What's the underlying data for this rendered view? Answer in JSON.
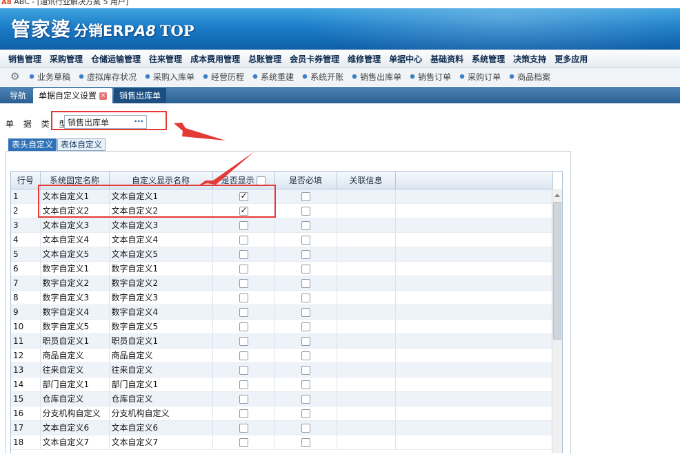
{
  "window": {
    "title": "ABC - [通讯行业解决方案 5 用户]"
  },
  "banner": {
    "logo_main": "管家婆",
    "logo_sub": "分销ERP",
    "logo_version": "A8",
    "logo_top": "TOP"
  },
  "main_menu": [
    "销售管理",
    "采购管理",
    "仓储运输管理",
    "往来管理",
    "成本费用管理",
    "总账管理",
    "会员卡券管理",
    "维修管理",
    "单据中心",
    "基础资料",
    "系统管理",
    "决策支持",
    "更多应用"
  ],
  "quick_bar": [
    "业务草稿",
    "虚拟库存状况",
    "采购入库单",
    "经营历程",
    "系统重建",
    "系统开账",
    "销售出库单",
    "销售订单",
    "采购订单",
    "商品档案"
  ],
  "tabs": [
    {
      "label": "导航"
    },
    {
      "label": "单据自定义设置",
      "close": "×"
    },
    {
      "label": "销售出库单"
    }
  ],
  "form": {
    "type_label": "单 据 类 型:",
    "type_value": "销售出库单",
    "type_button": "···"
  },
  "sub_tabs": [
    "表头自定义",
    "表体自定义"
  ],
  "grid": {
    "headers": [
      "行号",
      "系统固定名称",
      "自定义显示名称",
      "是否显示",
      "是否必填",
      "关联信息"
    ],
    "rows": [
      {
        "no": "1",
        "sys": "文本自定义1",
        "custom": "文本自定义1",
        "show": true,
        "required": false
      },
      {
        "no": "2",
        "sys": "文本自定义2",
        "custom": "文本自定义2",
        "show": true,
        "required": false
      },
      {
        "no": "3",
        "sys": "文本自定义3",
        "custom": "文本自定义3",
        "show": false,
        "required": false
      },
      {
        "no": "4",
        "sys": "文本自定义4",
        "custom": "文本自定义4",
        "show": false,
        "required": false
      },
      {
        "no": "5",
        "sys": "文本自定义5",
        "custom": "文本自定义5",
        "show": false,
        "required": false
      },
      {
        "no": "6",
        "sys": "数字自定义1",
        "custom": "数字自定义1",
        "show": false,
        "required": false
      },
      {
        "no": "7",
        "sys": "数字自定义2",
        "custom": "数字自定义2",
        "show": false,
        "required": false
      },
      {
        "no": "8",
        "sys": "数字自定义3",
        "custom": "数字自定义3",
        "show": false,
        "required": false
      },
      {
        "no": "9",
        "sys": "数字自定义4",
        "custom": "数字自定义4",
        "show": false,
        "required": false
      },
      {
        "no": "10",
        "sys": "数字自定义5",
        "custom": "数字自定义5",
        "show": false,
        "required": false
      },
      {
        "no": "11",
        "sys": "职员自定义1",
        "custom": "职员自定义1",
        "show": false,
        "required": false
      },
      {
        "no": "12",
        "sys": "商品自定义",
        "custom": "商品自定义",
        "show": false,
        "required": false
      },
      {
        "no": "13",
        "sys": "往来自定义",
        "custom": "往来自定义",
        "show": false,
        "required": false
      },
      {
        "no": "14",
        "sys": "部门自定义1",
        "custom": "部门自定义1",
        "show": false,
        "required": false
      },
      {
        "no": "15",
        "sys": "仓库自定义",
        "custom": "仓库自定义",
        "show": false,
        "required": false
      },
      {
        "no": "16",
        "sys": "分支机构自定义",
        "custom": "分支机构自定义",
        "show": false,
        "required": false
      },
      {
        "no": "17",
        "sys": "文本自定义6",
        "custom": "文本自定义6",
        "show": false,
        "required": false
      },
      {
        "no": "18",
        "sys": "文本自定义7",
        "custom": "文本自定义7",
        "show": false,
        "required": false
      }
    ]
  },
  "colors": {
    "banner": "#1c7dc8",
    "tabbar": "#2a5f93",
    "annotation": "#e53935",
    "row_alt": "#eef3fa"
  }
}
